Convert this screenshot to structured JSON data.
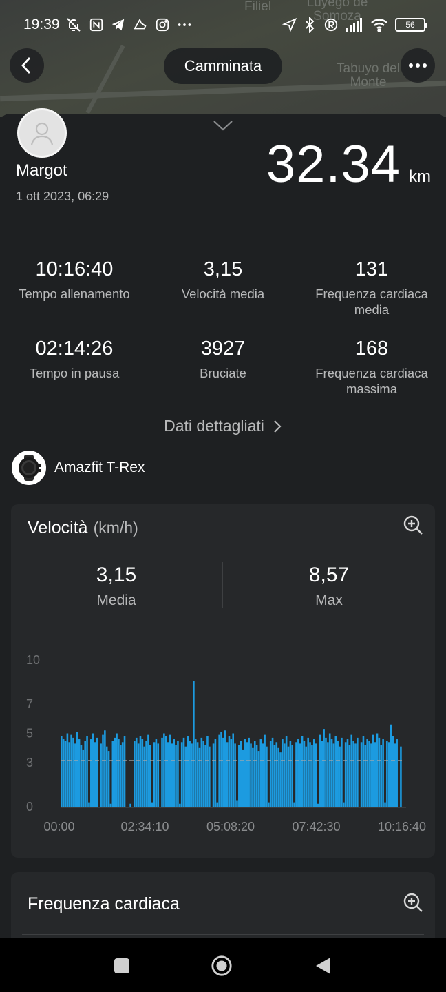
{
  "status_bar": {
    "time": "19:39",
    "battery": "56"
  },
  "map": {
    "places": [
      "Filiel",
      "Luyego de Somoza",
      "Tabuyo del Monte"
    ]
  },
  "header": {
    "title": "Camminata"
  },
  "summary": {
    "user_name": "Margot",
    "date": "1 ott 2023, 06:29",
    "distance_value": "32.34",
    "distance_unit": "km"
  },
  "stats": [
    {
      "value": "10:16:40",
      "label": "Tempo allenamento"
    },
    {
      "value": "3,15",
      "label": "Velocità media"
    },
    {
      "value": "131",
      "label": "Frequenza cardiaca media"
    },
    {
      "value": "02:14:26",
      "label": "Tempo in pausa"
    },
    {
      "value": "3927",
      "label": "Bruciate"
    },
    {
      "value": "168",
      "label": "Frequenza cardiaca massima"
    }
  ],
  "details_link": "Dati dettagliati",
  "device": {
    "name": "Amazfit T-Rex"
  },
  "speed_card": {
    "title": "Velocità",
    "unit": "(km/h)",
    "avg_value": "3,15",
    "avg_label": "Media",
    "max_value": "8,57",
    "max_label": "Max"
  },
  "heart_card": {
    "title": "Frequenza cardiaca"
  },
  "chart_data": {
    "type": "bar",
    "title": "Velocità",
    "ylabel": "(km/h)",
    "ylim": [
      0,
      10
    ],
    "y_ticks": [
      "0",
      "3",
      "5",
      "7",
      "10"
    ],
    "x_ticks": [
      "00:00",
      "02:34:10",
      "05:08:20",
      "07:42:30",
      "10:16:40"
    ],
    "average": 3.15,
    "max": 8.57,
    "color": "#1c9be0",
    "values": [
      4.8,
      4.6,
      4.5,
      5.0,
      4.4,
      4.9,
      4.7,
      4.3,
      5.1,
      4.6,
      4.2,
      3.9,
      4.5,
      4.8,
      0.3,
      4.6,
      5.0,
      4.4,
      4.7,
      0,
      4.3,
      4.9,
      5.2,
      4.1,
      3.8,
      0.2,
      4.5,
      4.7,
      5.0,
      4.6,
      4.2,
      4.4,
      4.8,
      0,
      0,
      0.2,
      0,
      4.5,
      4.7,
      4.3,
      4.8,
      4.6,
      4.1,
      4.5,
      4.9,
      4.2,
      0.3,
      4.4,
      4.6,
      4.3,
      0,
      4.7,
      5.0,
      4.8,
      4.4,
      4.9,
      4.3,
      4.6,
      4.2,
      4.5,
      0.2,
      4.4,
      4.7,
      4.1,
      4.8,
      4.5,
      4.3,
      8.57,
      4.6,
      4.4,
      4.0,
      4.7,
      4.5,
      4.2,
      4.8,
      4.1,
      0,
      4.3,
      4.6,
      0.3,
      4.9,
      5.1,
      4.7,
      5.2,
      4.4,
      4.8,
      4.6,
      5.0,
      4.3,
      0.4,
      4.2,
      4.5,
      3.9,
      4.6,
      4.4,
      4.7,
      4.3,
      4.0,
      4.5,
      4.2,
      3.8,
      4.6,
      4.3,
      4.9,
      4.1,
      0.3,
      4.5,
      4.7,
      4.2,
      4.4,
      4.0,
      3.7,
      4.6,
      4.3,
      4.8,
      4.1,
      4.5,
      4.2,
      0.3,
      4.4,
      4.6,
      4.3,
      4.8,
      4.5,
      4.1,
      4.7,
      4.4,
      4.2,
      4.6,
      4.3,
      0.2,
      4.9,
      4.5,
      5.3,
      4.7,
      4.4,
      5.0,
      4.6,
      4.3,
      4.8,
      4.5,
      4.1,
      4.7,
      0.3,
      4.4,
      4.6,
      4.2,
      4.9,
      4.5,
      4.3,
      4.7,
      0,
      4.4,
      4.8,
      4.2,
      4.6,
      4.5,
      4.3,
      4.9,
      4.4,
      5.0,
      4.7,
      4.2,
      4.6,
      0.3,
      4.5,
      4.4,
      5.6,
      4.8,
      4.3,
      4.6,
      0,
      4.1
    ]
  }
}
